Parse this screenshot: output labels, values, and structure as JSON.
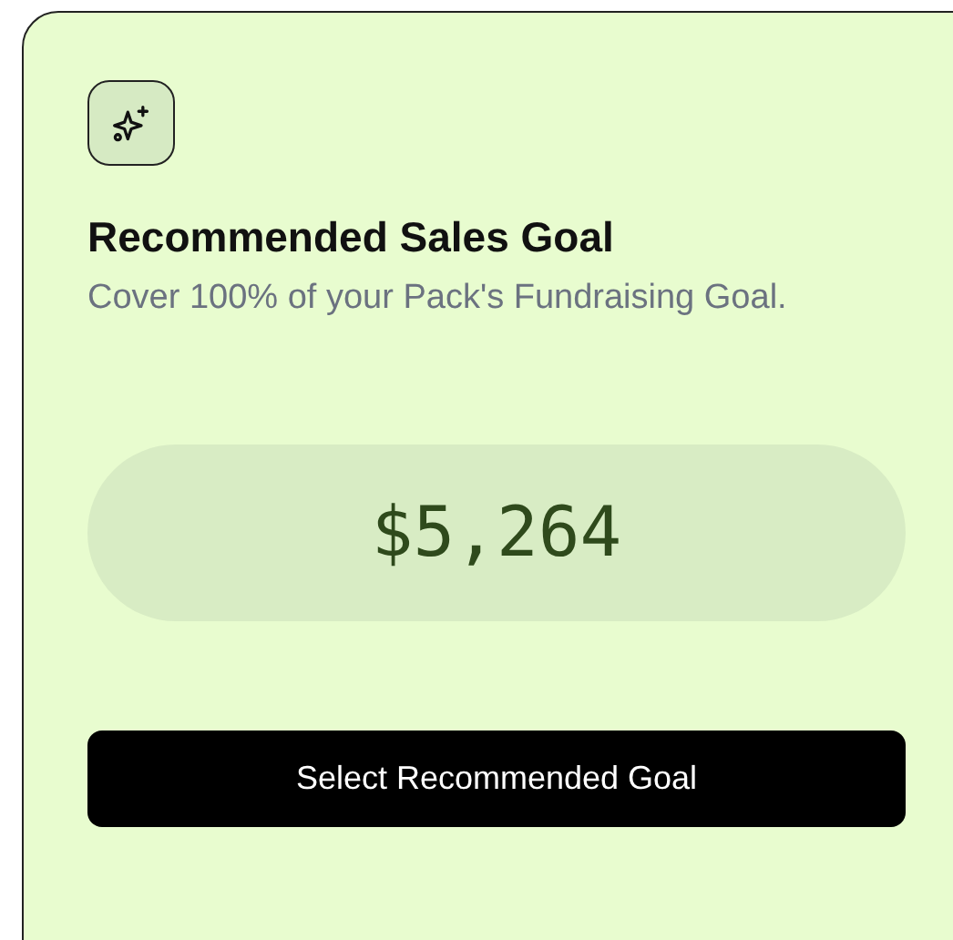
{
  "card": {
    "title": "Recommended Sales Goal",
    "description": "Cover 100% of your Pack's Fundraising Goal.",
    "amount": "$5,264",
    "button": "Select Recommended Goal"
  }
}
